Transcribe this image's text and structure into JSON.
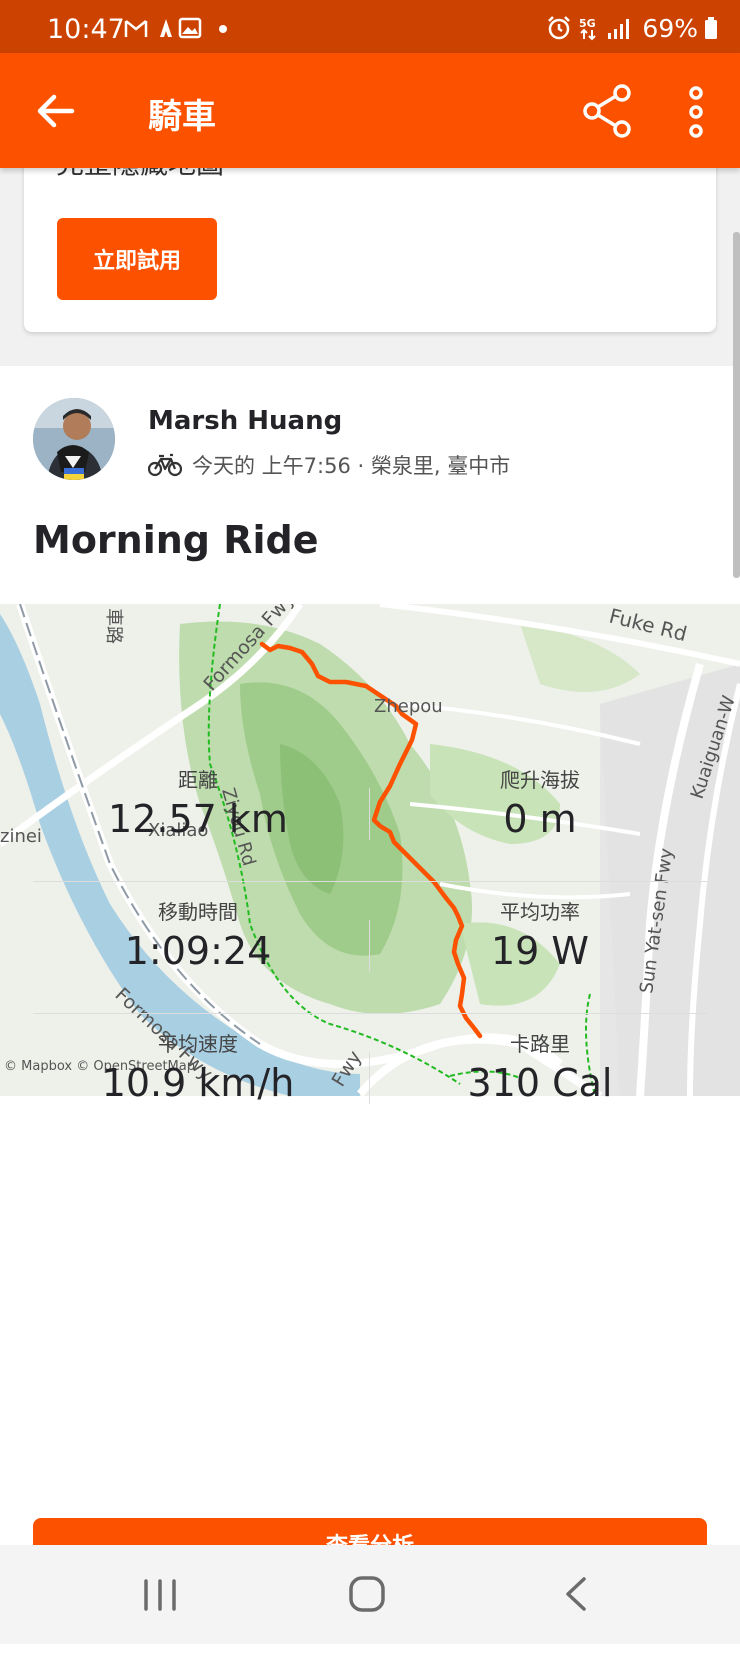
{
  "status_bar": {
    "time": "10:47",
    "battery": "69%",
    "network": "5G"
  },
  "app_bar": {
    "title": "騎車"
  },
  "promo": {
    "text": "完整隱藏地圖",
    "button_label": "立即試用"
  },
  "activity": {
    "athlete_name": "Marsh Huang",
    "meta": "今天的 上午7:56 · 榮泉里, 臺中市",
    "title": "Morning Ride"
  },
  "map": {
    "labels": [
      "Fuke Rd",
      "Formosa Fwy",
      "Zhepou",
      "Ziyou Rd",
      "Xialiao",
      "zinei",
      "Formosa Fwy",
      "Fwy",
      "Sun Yat-sen Fwy",
      "Kuaiguan-W",
      "車路"
    ],
    "attribution": "© Mapbox © OpenStreetMap",
    "route_color": "#fc5200"
  },
  "stats": [
    {
      "label": "距離",
      "value": "12.57 km"
    },
    {
      "label": "爬升海拔",
      "value": "0 m"
    },
    {
      "label": "移動時間",
      "value": "1:09:24"
    },
    {
      "label": "平均功率",
      "value": "19 W"
    },
    {
      "label": "平均速度",
      "value": "10.9 km/h"
    },
    {
      "label": "卡路里",
      "value": "310 Cal"
    }
  ],
  "actions": {
    "analysis_label": "查看分析"
  },
  "colors": {
    "brand": "#fc5200",
    "status_bar": "#cc4200"
  }
}
